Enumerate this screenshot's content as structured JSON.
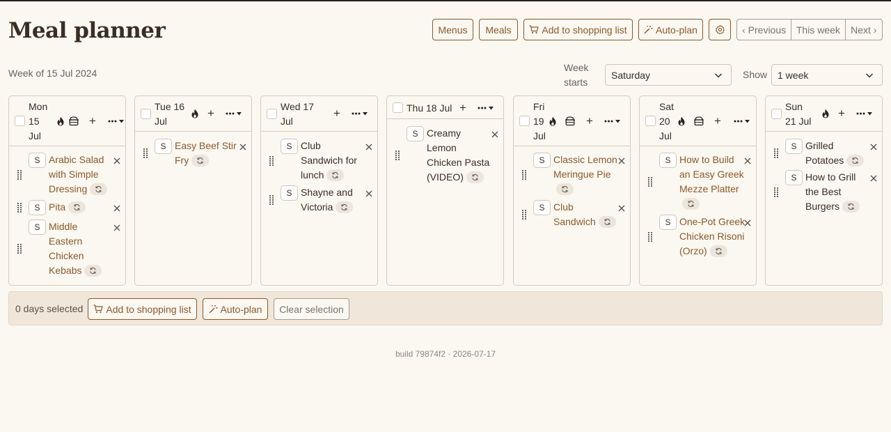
{
  "title": "Meal planner",
  "toolbar": {
    "menus": "Menus",
    "meals": "Meals",
    "add_to_shopping_list": "Add to shopping list",
    "auto_plan": "Auto-plan",
    "settings_icon": "gear-icon",
    "previous": "‹ Previous",
    "this_week": "This week",
    "next": "Next ›"
  },
  "week_of": "Week of 15 Jul 2024",
  "week_starts": {
    "label": "Week starts",
    "value": "Saturday"
  },
  "show": {
    "label": "Show",
    "value": "1 week"
  },
  "days": [
    {
      "name": "Mon 15 Jul",
      "lines": [
        "Mon",
        "15",
        "Jul"
      ],
      "meals": [
        {
          "badge": "S",
          "lines": [
            "Arabic Salad",
            "with Simple",
            "Dressing"
          ]
        },
        {
          "badge": "S",
          "lines": [
            "Pita"
          ]
        },
        {
          "badge": "S",
          "lines": [
            "Middle",
            "Eastern",
            "Chicken",
            "Kebabs"
          ]
        }
      ]
    },
    {
      "name": "Tue 16 Jul",
      "lines": [
        "Tue 16",
        "Jul"
      ],
      "meals": [
        {
          "badge": "S",
          "lines": [
            "Easy Beef Stir",
            "Fry"
          ]
        }
      ]
    },
    {
      "name": "Wed 17 Jul",
      "lines": [
        "Wed 17",
        "Jul"
      ],
      "meals": [
        {
          "badge": "S",
          "lines": [
            "Club",
            "Sandwich for",
            "lunch"
          ]
        },
        {
          "badge": "S",
          "lines": [
            "Shayne and",
            "Victoria"
          ]
        }
      ]
    },
    {
      "name": "Thu 18 Jul",
      "lines": [
        "Thu 18 Jul"
      ],
      "meals": [
        {
          "badge": "S",
          "lines": [
            "Creamy",
            "Lemon",
            "Chicken Pasta",
            "(VIDEO)"
          ]
        }
      ]
    },
    {
      "name": "Fri 19 Jul",
      "lines": [
        "Fri",
        "19",
        "Jul"
      ],
      "meals": [
        {
          "badge": "S",
          "lines": [
            "Classic Lemon",
            "Meringue Pie",
            ""
          ]
        },
        {
          "badge": "S",
          "lines": [
            "Club",
            "Sandwich"
          ]
        }
      ]
    },
    {
      "name": "Sat 20 Jul",
      "lines": [
        "Sat",
        "20",
        "Jul"
      ],
      "meals": [
        {
          "badge": "S",
          "lines": [
            "How to Build",
            "an Easy Greek",
            "Mezze Platter",
            ""
          ]
        },
        {
          "badge": "S",
          "lines": [
            "One-Pot Greek",
            "Chicken Risoni",
            "(Orzo)"
          ]
        }
      ]
    },
    {
      "name": "Sun 21 Jul",
      "lines": [
        "Sun",
        "21 Jul"
      ],
      "meals": [
        {
          "badge": "S",
          "lines": [
            "Grilled",
            "Potatoes"
          ]
        },
        {
          "badge": "S",
          "lines": [
            "How to Grill",
            "the Best",
            "Burgers"
          ]
        }
      ]
    }
  ],
  "selection": {
    "text": "0 days selected",
    "add_to_shopping_list": "Add to shopping list",
    "auto_plan": "Auto-plan",
    "clear": "Clear selection"
  },
  "footer": "build 79874f2 · 2026-07-17",
  "colors": {
    "accent": "#8a5a2b",
    "background": "#fbf7f1",
    "panel": "#f0e6da",
    "text": "#3a2e22"
  }
}
